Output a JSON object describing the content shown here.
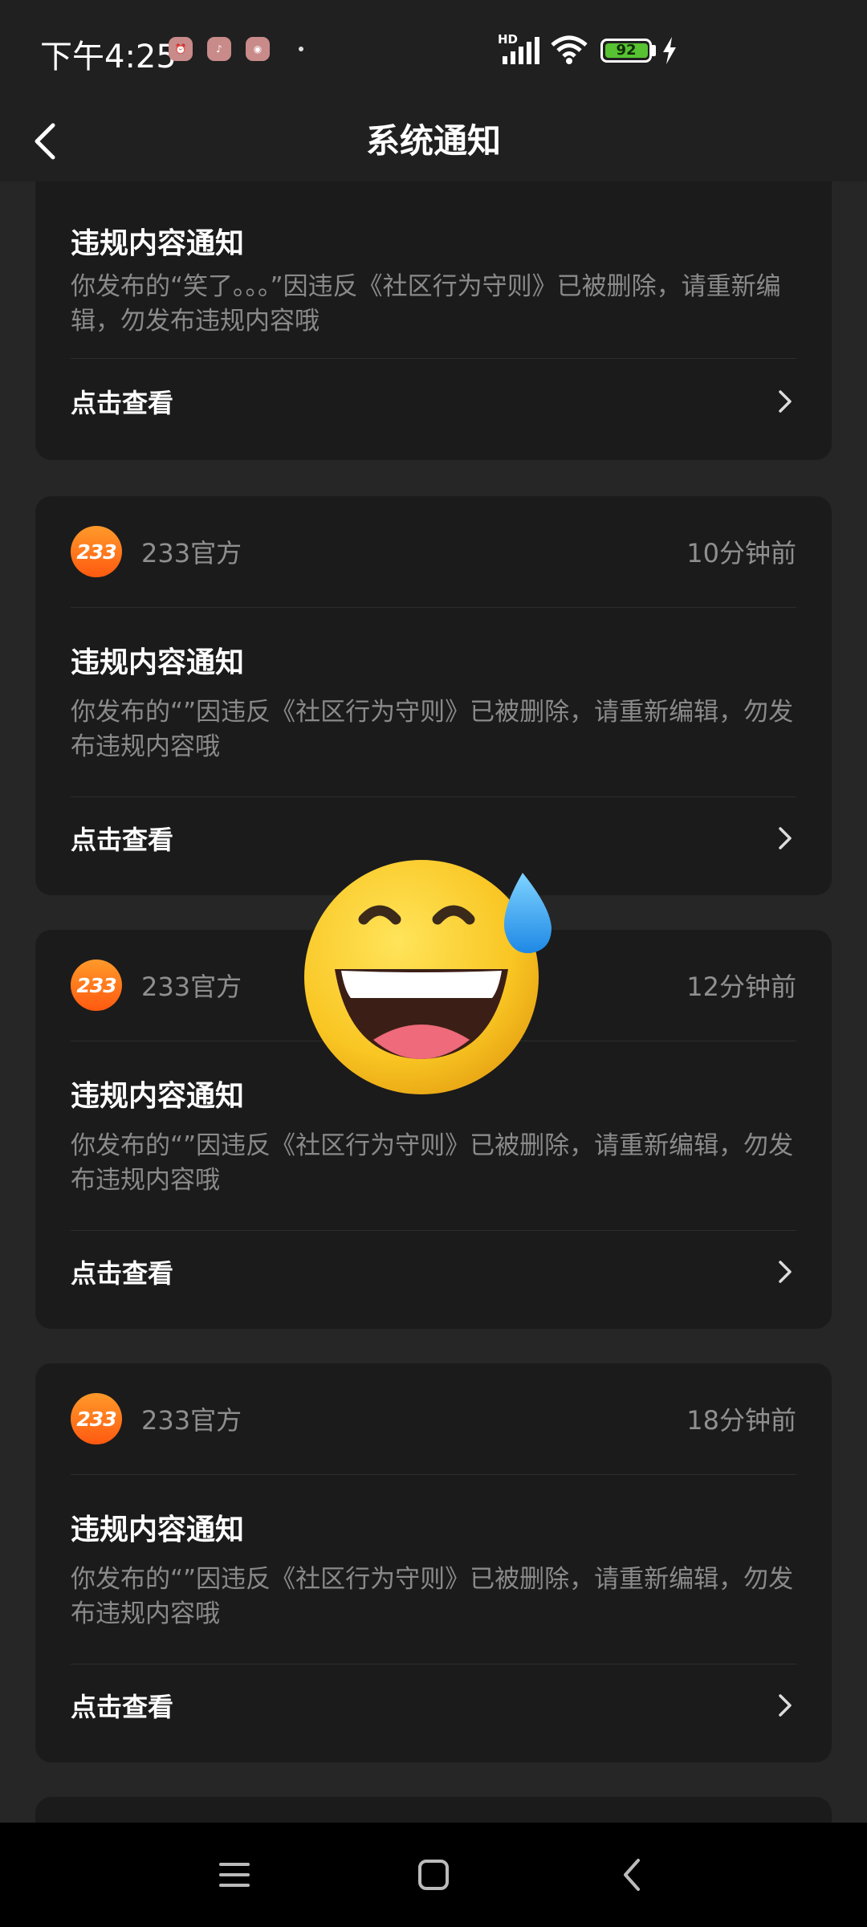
{
  "status_bar": {
    "time": "下午4:25",
    "app_icons": [
      "alarm-app-icon",
      "tiktok-app-icon",
      "camera-app-icon"
    ],
    "network": "HD",
    "battery": "92",
    "icons": [
      "signal-icon",
      "wifi-icon",
      "battery-icon",
      "charging-icon"
    ]
  },
  "header": {
    "title": "系统通知"
  },
  "cards": [
    {
      "sender": "",
      "time": "",
      "title": "违规内容通知",
      "message": "你发布的“笑了。。。”因违反《社区行为守则》已被删除，请重新编辑，勿发布违规内容哦",
      "action": "点击查看"
    },
    {
      "sender": "233官方",
      "time": "10分钟前",
      "title": "违规内容通知",
      "message": "你发布的“”因违反《社区行为守则》已被删除，请重新编辑，勿发布违规内容哦",
      "action": "点击查看"
    },
    {
      "sender": "233官方",
      "time": "12分钟前",
      "title": "违规内容通知",
      "message": "你发布的“”因违反《社区行为守则》已被删除，请重新编辑，勿发布违规内容哦",
      "action": "点击查看"
    },
    {
      "sender": "233官方",
      "time": "18分钟前",
      "title": "违规内容通知",
      "message": "你发布的“”因违反《社区行为守则》已被删除，请重新编辑，勿发布违规内容哦",
      "action": "点击查看"
    }
  ],
  "avatar_text": "233",
  "overlay": {
    "emoji": "grinning-face-with-sweat-emoji"
  },
  "nav_bar": {
    "icons": [
      "menu-icon",
      "home-icon",
      "back-icon"
    ]
  },
  "colors": {
    "background": "#202020",
    "card": "#1b1b1b",
    "brand_orange": "#ff6a16",
    "battery_green": "#57c232"
  }
}
